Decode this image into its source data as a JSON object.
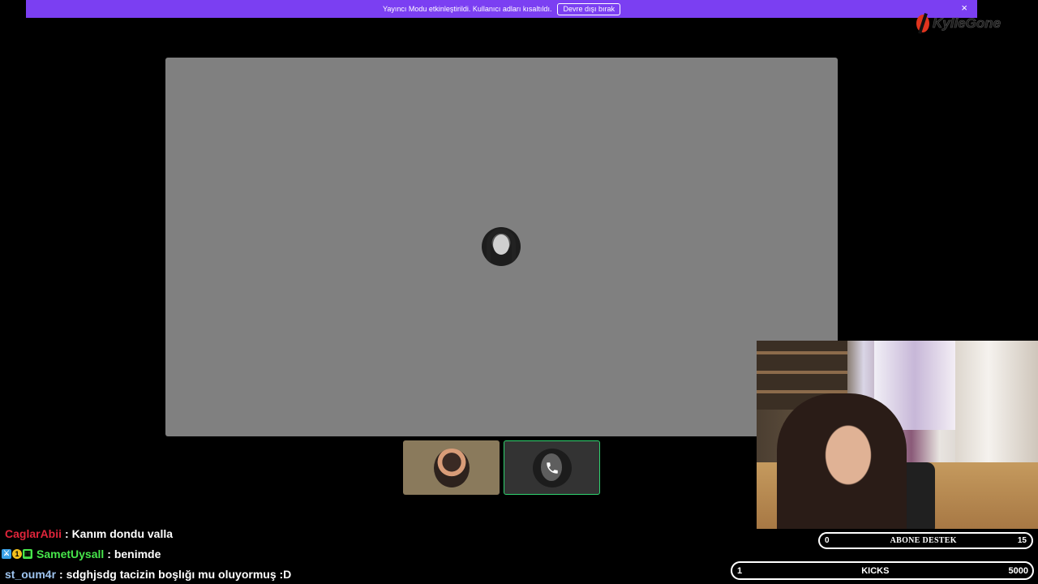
{
  "banner": {
    "message": "Yayıncı Modu etkinleştirildi. Kullanıcı adları kısaltıldı.",
    "disable_label": "Devre dışı bırak",
    "close_glyph": "×",
    "color": "#7b3ff2"
  },
  "logo": {
    "text": "KylieGone"
  },
  "tiles": [
    {
      "name": "participant-tile-1"
    },
    {
      "name": "participant-tile-2",
      "active": true,
      "accent": "#2fd36f"
    }
  ],
  "overlay": {
    "subs": {
      "left": "0",
      "title": "ABONE DESTEK",
      "right": "15"
    },
    "kicks": {
      "left": "1",
      "title": "KICKS",
      "right": "5000"
    }
  },
  "chat": [
    {
      "user": "CaglarAbii",
      "color": "#e0253b",
      "text": ": Kanım dondu valla"
    },
    {
      "user": "SametUysall",
      "color": "#47e64b",
      "text": ": benimde",
      "badges": [
        "⚔",
        "1",
        "▦"
      ]
    },
    {
      "user": "st_oum4r",
      "color": "#9ec4ef",
      "text": ": sdghjsdg tacizin boşlığı mu oluyormuş :D"
    }
  ]
}
